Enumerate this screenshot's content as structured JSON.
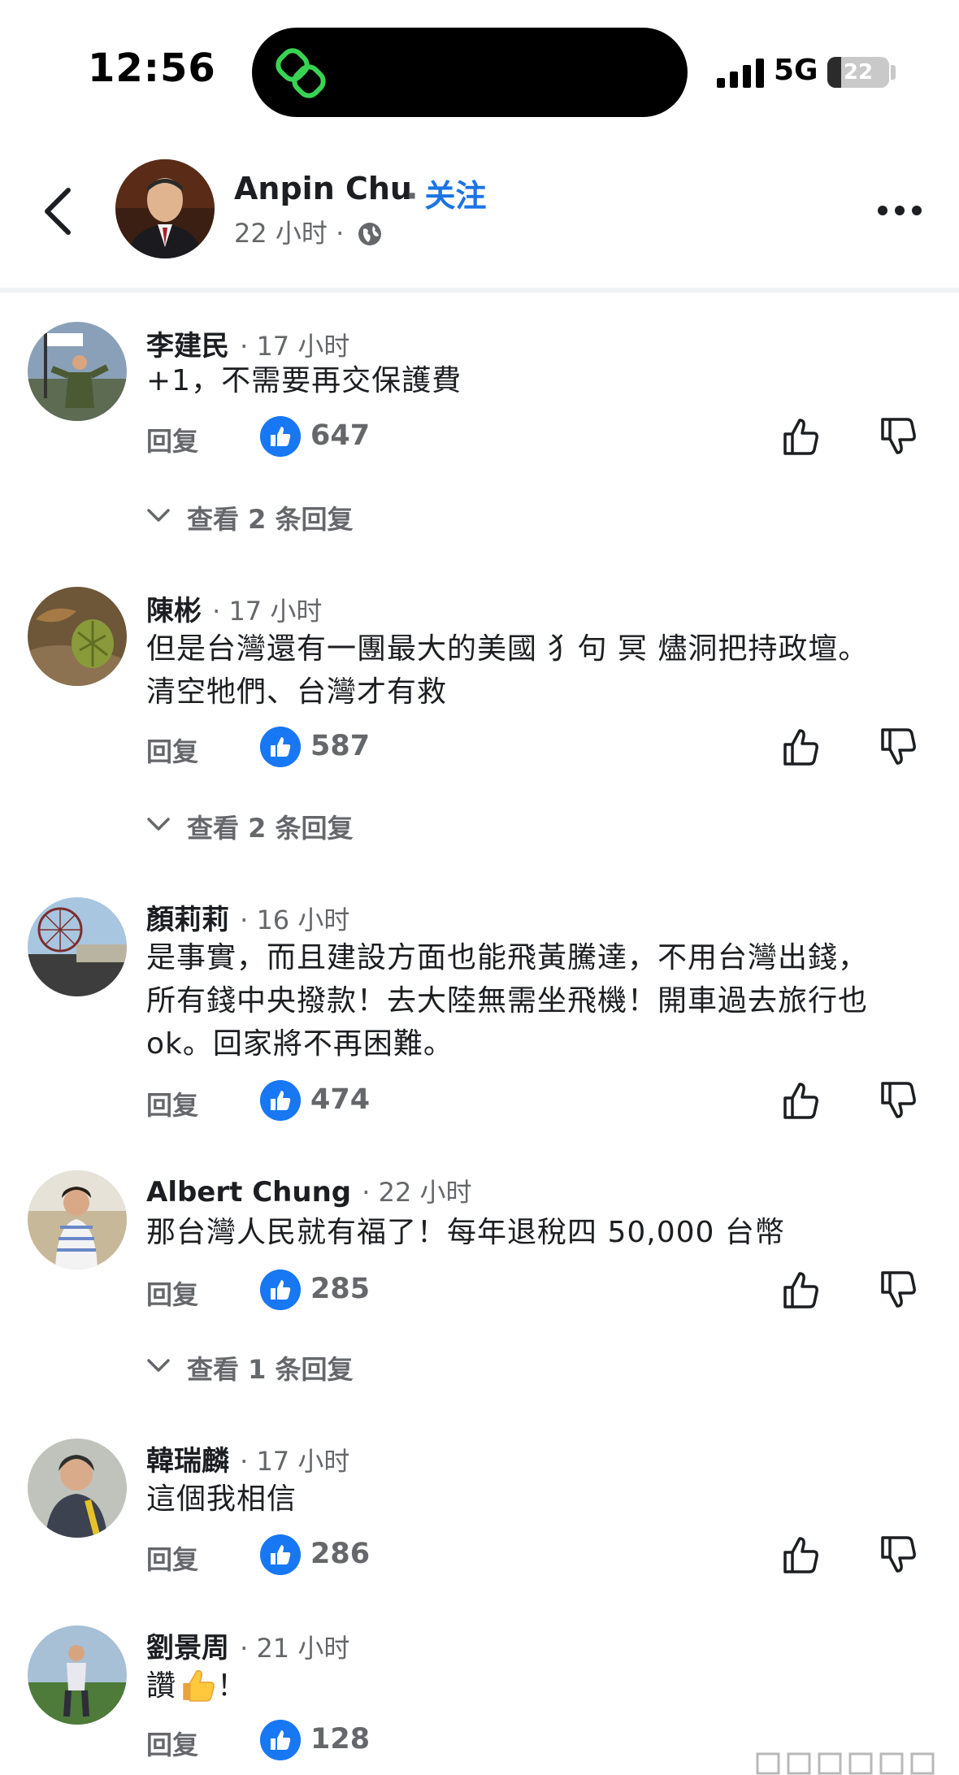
{
  "status_bar": {
    "time": "12:56",
    "network": "5G",
    "battery": "22",
    "battery_level_percent": 22
  },
  "header": {
    "author_name": "Anpin Chu",
    "follow_label": "关注",
    "post_time": "22 小时 ·"
  },
  "comments": [
    {
      "name": "李建民",
      "time": "· 17 小时",
      "text": "+1，不需要再交保護費",
      "reply_label": "回复",
      "likes": "647",
      "view_replies": "查看 2 条回复"
    },
    {
      "name": "陳彬",
      "time": "· 17 小时",
      "text_line1": "但是台灣還有一團最大的美國 犭句 冥 燼洞把持政壇。",
      "text_line2": "清空牠們、台灣才有救",
      "reply_label": "回复",
      "likes": "587",
      "view_replies": "查看 2 条回复"
    },
    {
      "name": "顏莉莉",
      "time": "· 16 小时",
      "text_line1": "是事實，而且建設方面也能飛黃騰達，不用台灣出錢，",
      "text_line2": "所有錢中央撥款！去大陸無需坐飛機！開車過去旅行也",
      "text_line3": "ok。回家將不再困難。",
      "reply_label": "回复",
      "likes": "474"
    },
    {
      "name": "Albert Chung",
      "time": "· 22 小时",
      "text": "那台灣人民就有福了！每年退稅四 50,000 台幣",
      "reply_label": "回复",
      "likes": "285",
      "view_replies": "查看 1 条回复"
    },
    {
      "name": "韓瑞麟",
      "time": "· 17 小时",
      "text": "這個我相信",
      "reply_label": "回复",
      "likes": "286"
    },
    {
      "name": "劉景周",
      "time": "· 21 小时",
      "text_before": "讚",
      "text_after": "！",
      "reply_label": "回复",
      "likes": "128"
    }
  ],
  "colors": {
    "accent_blue": "#1b74e4",
    "like_blue": "#1877f2",
    "secondary_text": "#65676b",
    "primary_text": "#1c1e21",
    "app_icon_green": "#39d353"
  },
  "icons": {
    "back": "chevron-left-icon",
    "more": "more-horizontal-icon",
    "privacy": "globe-icon",
    "like_badge": "thumbs-up-icon",
    "like": "thumbs-up-outline-icon",
    "dislike": "thumbs-down-outline-icon",
    "expand": "chevron-down-icon",
    "emoji": "thumbs-up-emoji"
  }
}
